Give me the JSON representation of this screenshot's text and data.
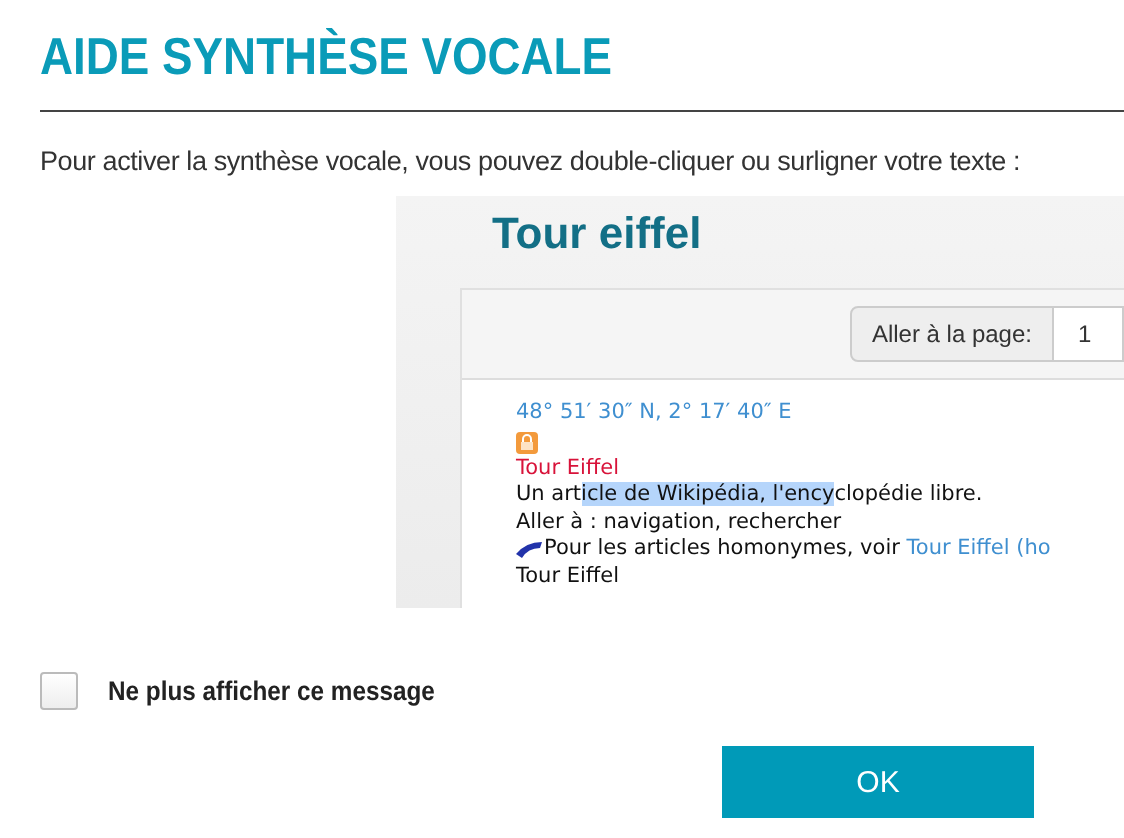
{
  "title": "AIDE SYNTHÈSE VOCALE",
  "instruction": "Pour activer la synthèse vocale, vous pouvez double-cliquer ou surligner votre texte :",
  "example": {
    "heading": "Tour eiffel",
    "page_label": "Aller à la page:",
    "page_value": "1",
    "lines": [
      {
        "kind": "coords",
        "text": "48° 51′ 30″ N, 2° 17′ 40″ E"
      },
      {
        "kind": "lock"
      },
      {
        "kind": "title",
        "text": "Tour Eiffel"
      },
      {
        "kind": "highlight",
        "before": "Un art",
        "highlighted": "icle de Wikipédia, l'ency",
        "after": "clopédie libre."
      },
      {
        "kind": "plain",
        "text": "Aller à : navigation, rechercher"
      },
      {
        "kind": "link",
        "text": "Pour les articles homonymes, voir ",
        "link": "Tour Eiffel (ho"
      },
      {
        "kind": "plain",
        "text": "Tour Eiffel"
      }
    ]
  },
  "checkbox": {
    "label": "Ne plus afficher ce message",
    "checked": false
  },
  "button": "OK"
}
